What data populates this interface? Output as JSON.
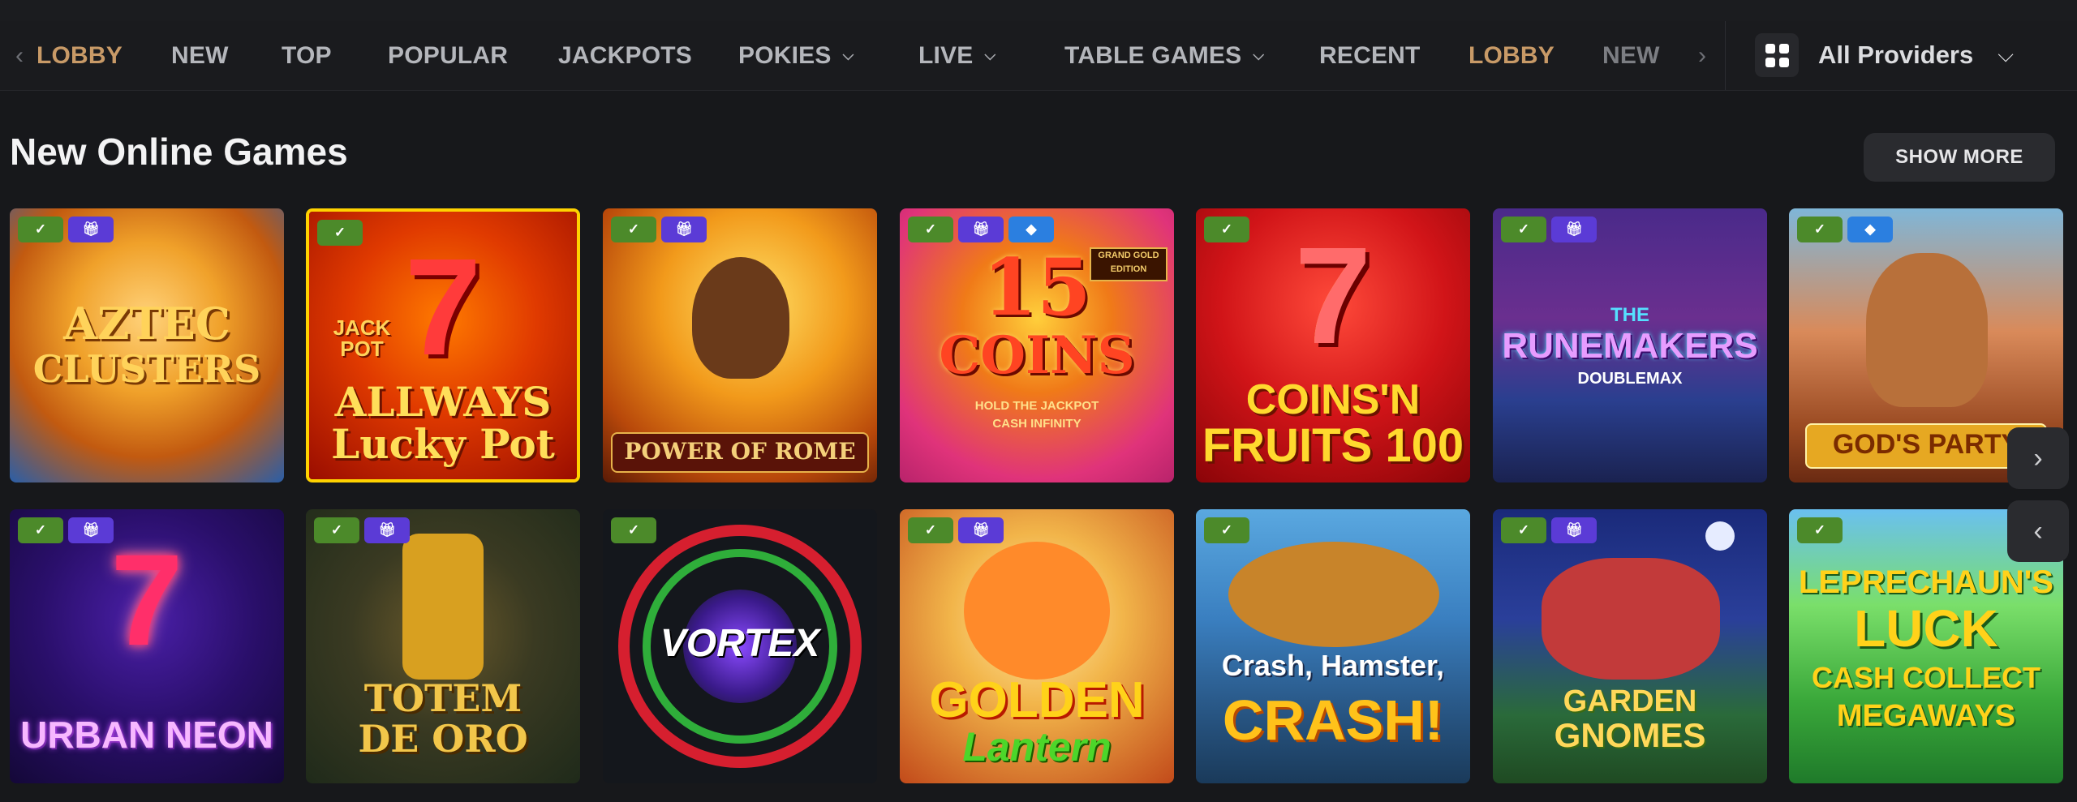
{
  "nav": {
    "items": [
      {
        "label": "LOBBY",
        "active": true,
        "dropdown": false
      },
      {
        "label": "NEW",
        "active": false,
        "dropdown": false
      },
      {
        "label": "TOP",
        "active": false,
        "dropdown": false
      },
      {
        "label": "POPULAR",
        "active": false,
        "dropdown": false
      },
      {
        "label": "JACKPOTS",
        "active": false,
        "dropdown": false
      },
      {
        "label": "POKIES",
        "active": false,
        "dropdown": true
      },
      {
        "label": "LIVE",
        "active": false,
        "dropdown": true
      },
      {
        "label": "TABLE GAMES",
        "active": false,
        "dropdown": true
      },
      {
        "label": "RECENT",
        "active": false,
        "dropdown": false
      },
      {
        "label": "LOBBY",
        "active": true,
        "dropdown": false
      },
      {
        "label": "NEW",
        "active": false,
        "dropdown": false
      }
    ]
  },
  "providers": {
    "label": "All Providers"
  },
  "section": {
    "title": "New Online Games",
    "show_more": "SHOW MORE"
  },
  "games": {
    "row1": [
      {
        "line1": "AZTEC",
        "line2": "CLUSTERS",
        "badges": [
          "green",
          "purple"
        ]
      },
      {
        "line1": "ALLWAYS",
        "line2": "Lucky Pot",
        "jackpot_tag": "JACK POT",
        "badges": [
          "green"
        ]
      },
      {
        "line1": "POWER OF ROME",
        "badges": [
          "green",
          "purple"
        ]
      },
      {
        "line1": "15",
        "line2": "COINS",
        "tagline1": "HOLD THE JACKPOT",
        "tagline2": "CASH INFINITY",
        "edition": "GRAND GOLD EDITION",
        "badges": [
          "green",
          "purple",
          "blue"
        ]
      },
      {
        "line1": "COINS'N",
        "line2": "FRUITS 100",
        "badges": [
          "green"
        ]
      },
      {
        "line0": "THE",
        "line1": "RUNEMAKERS",
        "line2": "DOUBLEMAX",
        "badges": [
          "green",
          "purple"
        ]
      },
      {
        "line1": "GOD'S PARTY",
        "badges": [
          "green",
          "blue"
        ]
      }
    ],
    "row2": [
      {
        "line1": "URBAN NEON",
        "badges": [
          "green",
          "purple"
        ]
      },
      {
        "line1": "TOTEM",
        "line2": "DE ORO",
        "badges": [
          "green",
          "purple"
        ]
      },
      {
        "line1": "VORTEX",
        "badges": [
          "green"
        ]
      },
      {
        "line1": "GOLDEN",
        "line2": "Lantern",
        "badges": [
          "green",
          "purple"
        ]
      },
      {
        "line1": "Crash, Hamster,",
        "line2": "CRASH!",
        "badges": [
          "green"
        ]
      },
      {
        "line1": "GARDEN",
        "line2": "GNOMES",
        "badges": [
          "green",
          "purple"
        ]
      },
      {
        "line1": "LEPRECHAUN'S",
        "line2": "LUCK",
        "line3": "CASH COLLECT",
        "line4": "MEGAWAYS",
        "badges": [
          "green"
        ]
      }
    ]
  },
  "icons": {
    "badge_green": "check-icon",
    "badge_purple": "gift-icon",
    "badge_blue": "diamond-icon",
    "nav_prev": "chevron-left-icon",
    "nav_next": "chevron-right-icon",
    "providers": "grid-icon"
  },
  "colors": {
    "accent": "#c89a67",
    "selected_border": "#ffd200",
    "badge_green": "#4c8a2a",
    "badge_purple": "#5b3bd6",
    "badge_blue": "#2b7fe0"
  }
}
